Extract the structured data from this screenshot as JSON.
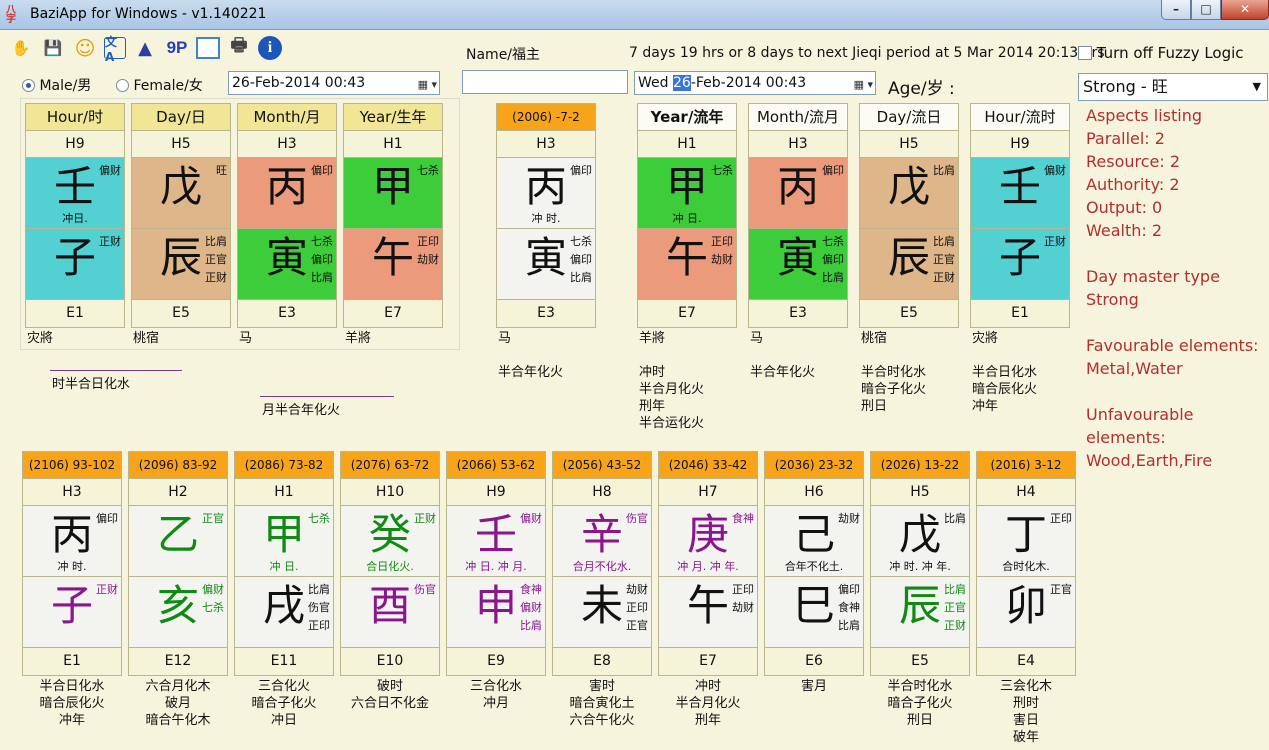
{
  "window": {
    "title": "BaziApp for Windows - v1.140221",
    "app_icon_text": "八字",
    "min": "–",
    "max": "□",
    "close": "✕"
  },
  "toolbar": {
    "items": [
      {
        "name": "open-icon",
        "glyph": "✋"
      },
      {
        "name": "save-icon",
        "glyph": "💾"
      },
      {
        "name": "smiley-icon",
        "glyph": "☺"
      },
      {
        "name": "translate-icon",
        "glyph": "文A"
      },
      {
        "name": "wizard-icon",
        "glyph": "▲"
      },
      {
        "name": "nine-p-icon",
        "glyph": "9P"
      },
      {
        "name": "window-icon",
        "glyph": ""
      },
      {
        "name": "print-icon",
        "glyph": "🖶"
      },
      {
        "name": "info-icon",
        "glyph": "i"
      }
    ]
  },
  "header": {
    "name_label": "Name/福主",
    "name_value": "",
    "jieqi_text": "7 days 19 hrs or 8 days to next Jieqi period at 5 Mar 2014 20:13 hrs",
    "fuzzy_label": "Turn off Fuzzy Logic",
    "fuzzy_checked": false,
    "male_label": "Male/男",
    "female_label": "Female/女",
    "gender": "male",
    "birth_datetime": "26-Feb-2014 00:43",
    "current_day": "Wed",
    "current_day_num": "26",
    "current_rest": "-Feb-2014 00:43",
    "age_label": "Age/岁 :",
    "strength_select": "Strong - 旺"
  },
  "natal": [
    {
      "label": "Hour/时",
      "h": "H9",
      "stem": "壬",
      "stem_color": "c-teal",
      "stem_side": [
        "偏财"
      ],
      "stem_sub": "冲日.",
      "branch": "子",
      "branch_color": "c-teal",
      "branch_side": [
        "正财"
      ],
      "e": "E1",
      "notes": [
        "灾將"
      ]
    },
    {
      "label": "Day/日",
      "h": "H5",
      "stem": "戊",
      "stem_color": "c-tan",
      "stem_side": [
        "旺"
      ],
      "stem_sub": "",
      "branch": "辰",
      "branch_color": "c-tan",
      "branch_side": [
        "比肩",
        "正官",
        "正财"
      ],
      "e": "E5",
      "notes": [
        "桃宿"
      ]
    },
    {
      "label": "Month/月",
      "h": "H3",
      "stem": "丙",
      "stem_color": "c-salmon",
      "stem_side": [
        "偏印"
      ],
      "stem_sub": "",
      "branch": "寅",
      "branch_color": "c-green",
      "branch_side": [
        "七杀",
        "偏印",
        "比肩"
      ],
      "e": "E3",
      "notes": [
        "马"
      ]
    },
    {
      "label": "Year/生年",
      "h": "H1",
      "stem": "甲",
      "stem_color": "c-green",
      "stem_side": [
        "七杀"
      ],
      "stem_sub": "",
      "branch": "午",
      "branch_color": "c-salmon",
      "branch_side": [
        "正印",
        "劫财"
      ],
      "e": "E7",
      "notes": [
        "羊將"
      ]
    }
  ],
  "natal_combos": [
    "时半合日化水",
    "月半合年化火"
  ],
  "luck_current": {
    "label": "(2006) -7-2",
    "h": "H3",
    "stem": "丙",
    "stem_side": [
      "偏印"
    ],
    "stem_sub": "冲 时.",
    "branch": "寅",
    "branch_side": [
      "七杀",
      "偏印",
      "比肩"
    ],
    "e": "E3",
    "notes": [
      "马",
      "",
      "半合年化火"
    ]
  },
  "flow": [
    {
      "label": "Year/流年",
      "h": "H1",
      "stem": "甲",
      "stem_color": "c-green",
      "stem_side": [
        "七杀"
      ],
      "stem_sub": "冲 日.",
      "branch": "午",
      "branch_color": "c-salmon",
      "branch_side": [
        "正印",
        "劫财"
      ],
      "e": "E7",
      "notes": [
        "羊將",
        "",
        "冲时",
        "半合月化火",
        "刑年",
        "半合运化火"
      ]
    },
    {
      "label": "Month/流月",
      "h": "H3",
      "stem": "丙",
      "stem_color": "c-salmon",
      "stem_side": [
        "偏印"
      ],
      "stem_sub": "",
      "branch": "寅",
      "branch_color": "c-green",
      "branch_side": [
        "七杀",
        "偏印",
        "比肩"
      ],
      "e": "E3",
      "notes": [
        "马",
        "",
        "半合年化火"
      ]
    },
    {
      "label": "Day/流日",
      "h": "H5",
      "stem": "戊",
      "stem_color": "c-tan",
      "stem_side": [
        "比肩"
      ],
      "stem_sub": "",
      "branch": "辰",
      "branch_color": "c-tan",
      "branch_side": [
        "比肩",
        "正官",
        "正财"
      ],
      "e": "E5",
      "notes": [
        "桃宿",
        "",
        "半合时化水",
        "暗合子化火",
        "刑日"
      ]
    },
    {
      "label": "Hour/流时",
      "h": "H9",
      "stem": "壬",
      "stem_color": "c-teal",
      "stem_side": [
        "偏财"
      ],
      "stem_sub": "",
      "branch": "子",
      "branch_color": "c-teal",
      "branch_side": [
        "正财"
      ],
      "e": "E1",
      "notes": [
        "灾將",
        "",
        "半合日化水",
        "暗合辰化火",
        "冲年"
      ]
    }
  ],
  "luck_pillars": [
    {
      "label": "(2106) 93-102",
      "h": "H3",
      "stem": "丙",
      "stem_tc": "t-black",
      "stem_side": [
        "偏印"
      ],
      "stem_sub": "冲 时.",
      "branch": "子",
      "branch_tc": "t-purple",
      "branch_side": [
        "正财"
      ],
      "e": "E1",
      "notes": [
        "半合日化水",
        "暗合辰化火",
        "冲年"
      ]
    },
    {
      "label": "(2096) 83-92",
      "h": "H2",
      "stem": "乙",
      "stem_tc": "t-green",
      "stem_side": [
        "正官"
      ],
      "stem_sub": "",
      "branch": "亥",
      "branch_tc": "t-green",
      "branch_side": [
        "偏财",
        "七杀"
      ],
      "e": "E12",
      "notes": [
        "六合月化木",
        "破月",
        "暗合午化木"
      ]
    },
    {
      "label": "(2086) 73-82",
      "h": "H1",
      "stem": "甲",
      "stem_tc": "t-green",
      "stem_side": [
        "七杀"
      ],
      "stem_sub": "冲 日.",
      "branch": "戌",
      "branch_tc": "t-black",
      "branch_side": [
        "比肩",
        "伤官",
        "正印"
      ],
      "e": "E11",
      "notes": [
        "三合化火",
        "暗合子化火",
        "冲日"
      ]
    },
    {
      "label": "(2076) 63-72",
      "h": "H10",
      "stem": "癸",
      "stem_tc": "t-green",
      "stem_side": [
        "正财"
      ],
      "stem_sub": "合日化火.",
      "branch": "酉",
      "branch_tc": "t-purple",
      "branch_side": [
        "伤官"
      ],
      "e": "E10",
      "notes": [
        "破时",
        "六合日不化金"
      ]
    },
    {
      "label": "(2066) 53-62",
      "h": "H9",
      "stem": "壬",
      "stem_tc": "t-purple",
      "stem_side": [
        "偏财"
      ],
      "stem_sub": "冲 日. 冲 月.",
      "branch": "申",
      "branch_tc": "t-purple",
      "branch_side": [
        "食神",
        "偏财",
        "比肩"
      ],
      "e": "E9",
      "notes": [
        "三合化水",
        "冲月"
      ]
    },
    {
      "label": "(2056) 43-52",
      "h": "H8",
      "stem": "辛",
      "stem_tc": "t-purple",
      "stem_side": [
        "伤官"
      ],
      "stem_sub": "合月不化水.",
      "branch": "未",
      "branch_tc": "t-black",
      "branch_side": [
        "劫财",
        "正印",
        "正官"
      ],
      "e": "E8",
      "notes": [
        "害时",
        "暗合寅化土",
        "六合午化火"
      ]
    },
    {
      "label": "(2046) 33-42",
      "h": "H7",
      "stem": "庚",
      "stem_tc": "t-purple",
      "stem_side": [
        "食神"
      ],
      "stem_sub": "冲 月. 冲 年.",
      "branch": "午",
      "branch_tc": "t-black",
      "branch_side": [
        "正印",
        "劫财"
      ],
      "e": "E7",
      "notes": [
        "冲时",
        "半合月化火",
        "刑年"
      ]
    },
    {
      "label": "(2036) 23-32",
      "h": "H6",
      "stem": "己",
      "stem_tc": "t-black",
      "stem_side": [
        "劫财"
      ],
      "stem_sub": "合年不化土.",
      "branch": "巳",
      "branch_tc": "t-black",
      "branch_side": [
        "偏印",
        "食神",
        "比肩"
      ],
      "e": "E6",
      "notes": [
        "害月"
      ]
    },
    {
      "label": "(2026) 13-22",
      "h": "H5",
      "stem": "戊",
      "stem_tc": "t-black",
      "stem_side": [
        "比肩"
      ],
      "stem_sub": "冲 时. 冲 年.",
      "branch": "辰",
      "branch_tc": "t-green",
      "branch_side": [
        "比肩",
        "正官",
        "正财"
      ],
      "e": "E5",
      "notes": [
        "半合时化水",
        "暗合子化火",
        "刑日"
      ]
    },
    {
      "label": "(2016) 3-12",
      "h": "H4",
      "stem": "丁",
      "stem_tc": "t-black",
      "stem_side": [
        "正印"
      ],
      "stem_sub": "合时化木.",
      "branch": "卯",
      "branch_tc": "t-black",
      "branch_side": [
        "正官"
      ],
      "e": "E4",
      "notes": [
        "三会化木",
        "刑时",
        "害日",
        "破年"
      ]
    }
  ],
  "aspects": {
    "heading": "Aspects listing",
    "lines": [
      "Parallel: 2",
      "Resource: 2",
      "Authority: 2",
      "Output: 0",
      "Wealth: 2"
    ],
    "dm_heading": "Day master type",
    "dm_value": "Strong",
    "fav_heading": "Favourable elements:",
    "fav_value": "Metal,Water",
    "unfav_heading": "Unfavourable elements:",
    "unfav_value": "Wood,Earth,Fire"
  }
}
